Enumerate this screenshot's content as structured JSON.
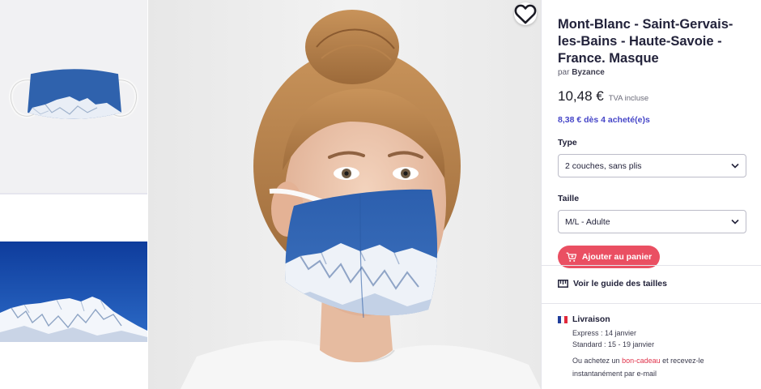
{
  "product": {
    "title": "Mont-Blanc - Saint-Gervais-les-Bains - Haute-Savoie - France. Masque",
    "byline_prefix": "par",
    "artist": "Byzance",
    "price": "10,48 €",
    "vat_note": "TVA incluse",
    "bulk_price": "8,38 € dès 4 acheté(e)s"
  },
  "options": {
    "type": {
      "label": "Type",
      "selected": "2 couches, sans plis"
    },
    "size": {
      "label": "Taille",
      "selected": "M/L - Adulte"
    }
  },
  "actions": {
    "add_to_cart": "Ajouter au panier",
    "size_guide": "Voir le guide des tailles"
  },
  "delivery": {
    "title": "Livraison",
    "express": "Express : 14 janvier",
    "standard": "Standard : 15 - 19 janvier",
    "gift_prefix": "Ou achetez un",
    "gift_link": "bon-cadeau",
    "gift_suffix": "et recevez-le instantanément par e-mail"
  },
  "icons": {
    "favorite": "heart-icon",
    "select_arrow": "chevron-down-icon",
    "cart": "cart-icon",
    "ruler": "ruler-icon",
    "flag": "france-flag-icon"
  },
  "colors": {
    "accent_button": "#ea4f62",
    "bulk_price": "#4646c8",
    "gift_link": "#e0334b",
    "sky_blue": "#2e63b0"
  }
}
